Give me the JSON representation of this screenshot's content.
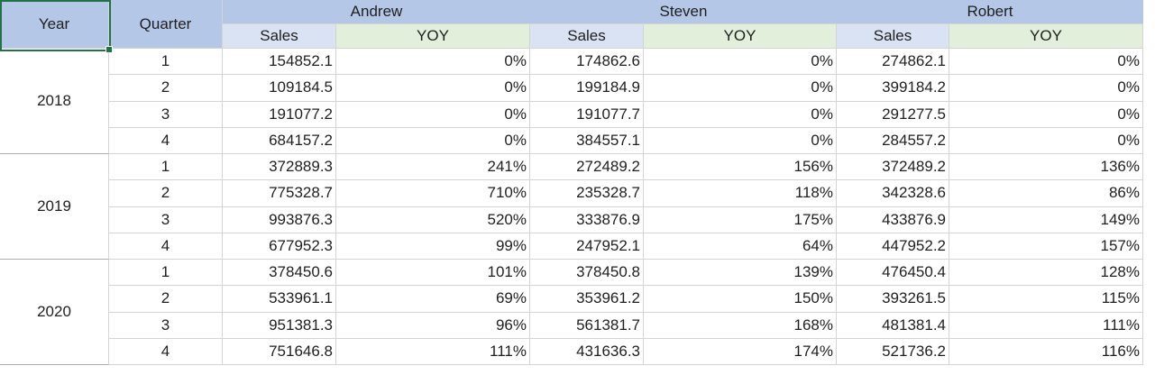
{
  "header": {
    "year_label": "Year",
    "quarter_label": "Quarter",
    "people": [
      "Andrew",
      "Steven",
      "Robert"
    ],
    "sales_label": "Sales",
    "yoy_label": "YOY"
  },
  "years": [
    {
      "label": "2018",
      "rows": [
        {
          "quarter": "1",
          "cells": [
            "154852.1",
            "0%",
            "174862.6",
            "0%",
            "274862.1",
            "0%"
          ]
        },
        {
          "quarter": "2",
          "cells": [
            "109184.5",
            "0%",
            "199184.9",
            "0%",
            "399184.2",
            "0%"
          ]
        },
        {
          "quarter": "3",
          "cells": [
            "191077.2",
            "0%",
            "191077.7",
            "0%",
            "291277.5",
            "0%"
          ]
        },
        {
          "quarter": "4",
          "cells": [
            "684157.2",
            "0%",
            "384557.1",
            "0%",
            "284557.2",
            "0%"
          ]
        }
      ]
    },
    {
      "label": "2019",
      "rows": [
        {
          "quarter": "1",
          "cells": [
            "372889.3",
            "241%",
            "272489.2",
            "156%",
            "372489.2",
            "136%"
          ]
        },
        {
          "quarter": "2",
          "cells": [
            "775328.7",
            "710%",
            "235328.7",
            "118%",
            "342328.6",
            "86%"
          ]
        },
        {
          "quarter": "3",
          "cells": [
            "993876.3",
            "520%",
            "333876.9",
            "175%",
            "433876.9",
            "149%"
          ]
        },
        {
          "quarter": "4",
          "cells": [
            "677952.3",
            "99%",
            "247952.1",
            "64%",
            "447952.2",
            "157%"
          ]
        }
      ]
    },
    {
      "label": "2020",
      "rows": [
        {
          "quarter": "1",
          "cells": [
            "378450.6",
            "101%",
            "378450.8",
            "139%",
            "476450.4",
            "128%"
          ]
        },
        {
          "quarter": "2",
          "cells": [
            "533961.1",
            "69%",
            "353961.2",
            "150%",
            "393261.5",
            "115%"
          ]
        },
        {
          "quarter": "3",
          "cells": [
            "951381.3",
            "96%",
            "561381.7",
            "168%",
            "481381.4",
            "111%"
          ]
        },
        {
          "quarter": "4",
          "cells": [
            "751646.8",
            "111%",
            "431636.3",
            "174%",
            "521736.2",
            "116%"
          ]
        }
      ]
    }
  ],
  "colors": {
    "header_fill": "#b4c7e7",
    "sales_header_fill": "#dae3f3",
    "yoy_header_fill": "#e2efda",
    "selection_border": "#217346"
  }
}
